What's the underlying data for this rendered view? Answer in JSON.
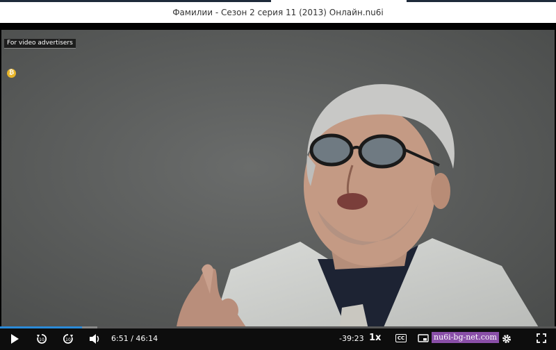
{
  "page": {
    "title": "Фамилии - Сезон 2 серия 11 (2013) Онлайн.nu6i"
  },
  "player": {
    "advert_label": "For video advertisers",
    "coin_glyph": "₿",
    "current_time": "6:51",
    "time_separator": "/",
    "duration": "46:14",
    "remaining_time": "-39:23",
    "speed": "1x",
    "cc_label": "CC",
    "watermark": "nu6i-bg-net.com",
    "progress_fraction": 0.148,
    "buffered_fraction": 0.175,
    "accent_color": "#2b8bd8"
  }
}
